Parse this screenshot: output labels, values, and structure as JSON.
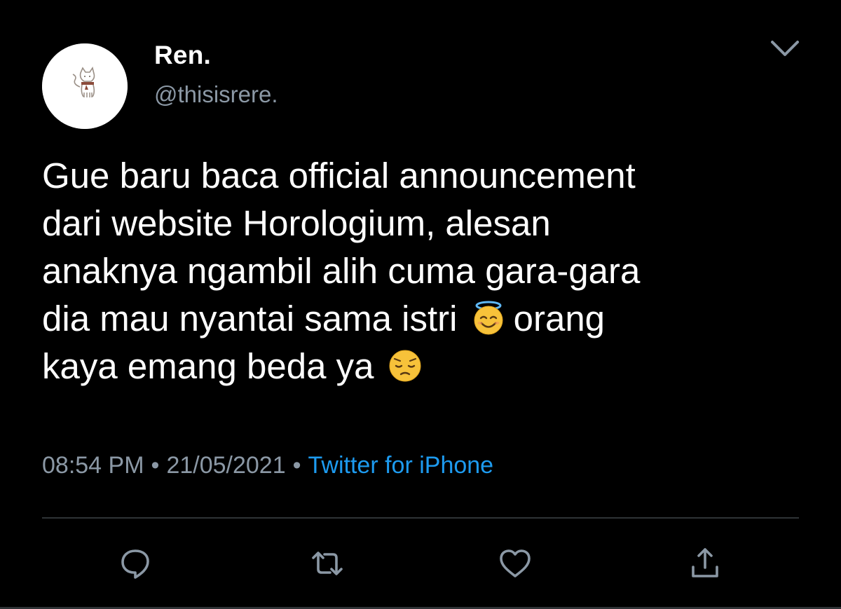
{
  "author": {
    "display_name": "Ren.",
    "handle": "@thisisrere."
  },
  "tweet": {
    "lines": [
      {
        "text": "Gue baru baca official announcement"
      },
      {
        "text": "dari website Horologium, alesan"
      },
      {
        "text": "anaknya ngambil alih cuma gara-gara"
      },
      {
        "text": "dia mau nyantai sama istri",
        "emoji": "smiling-face-with-halo",
        "after": "orang"
      },
      {
        "text": "kaya emang beda ya",
        "emoji": "pensive-face"
      }
    ]
  },
  "meta": {
    "time": "08:54 PM",
    "separator": "•",
    "date": "21/05/2021",
    "source": "Twitter for iPhone"
  },
  "actions": {
    "reply_icon": "reply-icon",
    "retweet_icon": "retweet-icon",
    "like_icon": "heart-icon",
    "share_icon": "share-icon"
  },
  "colors": {
    "background": "#000000",
    "text": "#ffffff",
    "secondary_text": "#8b98a5",
    "link": "#1d9bf0",
    "divider": "#2f3336"
  }
}
